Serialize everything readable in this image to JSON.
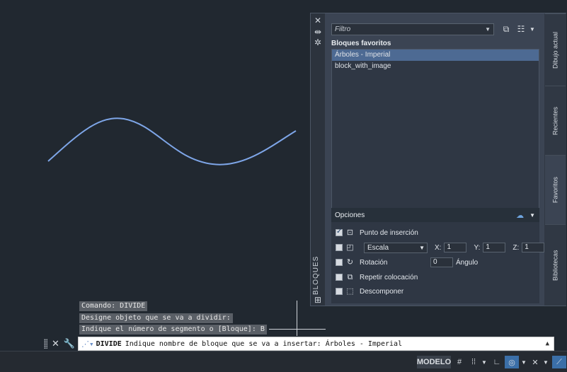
{
  "command_history": [
    "Comando: DIVIDE",
    "Designe objeto que se va a dividir:",
    "Indique el número de segmento o [Bloque]: B"
  ],
  "command_line": {
    "command": "DIVIDE",
    "text": "Indique nombre de bloque que se va a insertar: Árboles - Imperial"
  },
  "palette": {
    "title": "BLOQUES",
    "filter_placeholder": "Filtro",
    "favorites_title": "Bloques favoritos",
    "favorites": [
      "Árboles - Imperial",
      "block_with_image"
    ],
    "selected_index": 0,
    "side_tabs": [
      "Dibujo actual",
      "Recientes",
      "Favoritos",
      "Bibliotecas"
    ],
    "active_tab": "Favoritos",
    "options": {
      "title": "Opciones",
      "insertion_point": "Punto de inserción",
      "insertion_point_checked": true,
      "scale_combo": "Escala",
      "x_label": "X:",
      "x_value": "1",
      "y_label": "Y:",
      "y_value": "1",
      "z_label": "Z:",
      "z_value": "1",
      "rotation": "Rotación",
      "rotation_value": "0",
      "angle_label": "Ángulo",
      "repeat": "Repetir colocación",
      "explode": "Descomponer"
    }
  },
  "statusbar": {
    "model_label": "MODELO"
  },
  "colors": {
    "canvas": "#212830",
    "curve": "#7ea6e8",
    "selection": "#4d6a93",
    "status_active": "#3b6fa8"
  },
  "icons": [
    "close-icon",
    "pin-icon",
    "gear-icon",
    "palette-icon",
    "wrench-icon",
    "grid-icon",
    "snap-icon",
    "ortho-icon",
    "polar-icon",
    "osnap-icon",
    "scale-icon"
  ]
}
